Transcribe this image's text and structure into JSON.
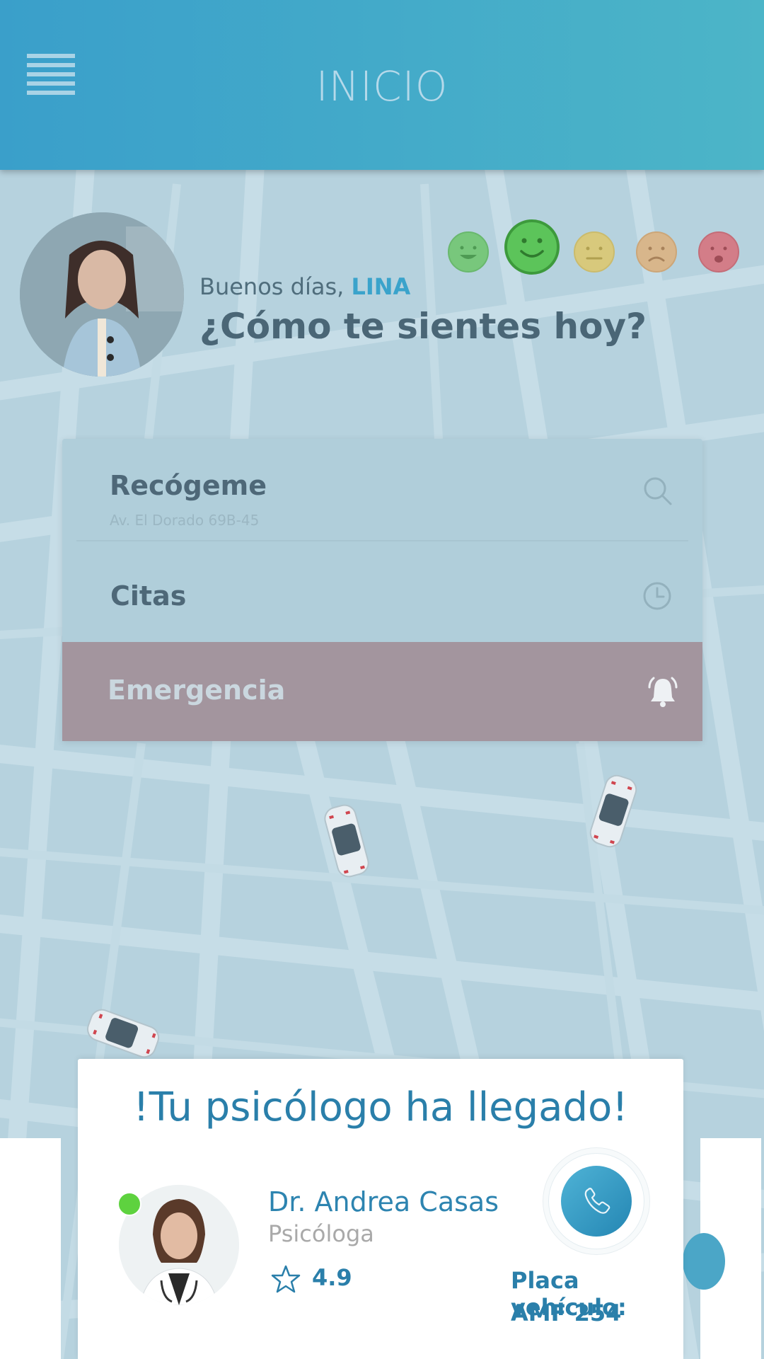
{
  "header": {
    "title": "INICIO",
    "menu_icon": "hamburger-menu-icon"
  },
  "greeting": {
    "salutation": "Buenos días, ",
    "name": "LINA",
    "question": "¿Cómo te sientes hoy?"
  },
  "moods": [
    {
      "name": "very-happy-face-icon",
      "color": "#76c97a",
      "selected": false
    },
    {
      "name": "happy-face-icon",
      "color": "#5cc45a",
      "selected": true
    },
    {
      "name": "neutral-face-icon",
      "color": "#d9c97a",
      "selected": false
    },
    {
      "name": "sad-face-icon",
      "color": "#d9b58a",
      "selected": false
    },
    {
      "name": "very-sad-face-icon",
      "color": "#d37c86",
      "selected": false
    }
  ],
  "actions": {
    "pickup": {
      "label": "Recógeme",
      "address": "Av. El Dorado 69B-45",
      "icon": "search-icon"
    },
    "appointments": {
      "label": "Citas",
      "icon": "clock-icon"
    },
    "emergency": {
      "label": "Emergencia",
      "icon": "alarm-bell-icon",
      "color": "#a3959e"
    }
  },
  "arrival": {
    "title": "!Tu psicólogo ha llegado!",
    "doctor_name": "Dr. Andrea Casas",
    "role": "Psicóloga",
    "rating": "4.9",
    "rating_icon": "star-icon",
    "status": "online",
    "call_icon": "phone-icon",
    "plate_label": "Placa vehículo:",
    "plate_value": "AMF 254"
  },
  "colors": {
    "header": "#3a9fca",
    "accent": "#2a7faa",
    "map": "#b6d2de"
  }
}
